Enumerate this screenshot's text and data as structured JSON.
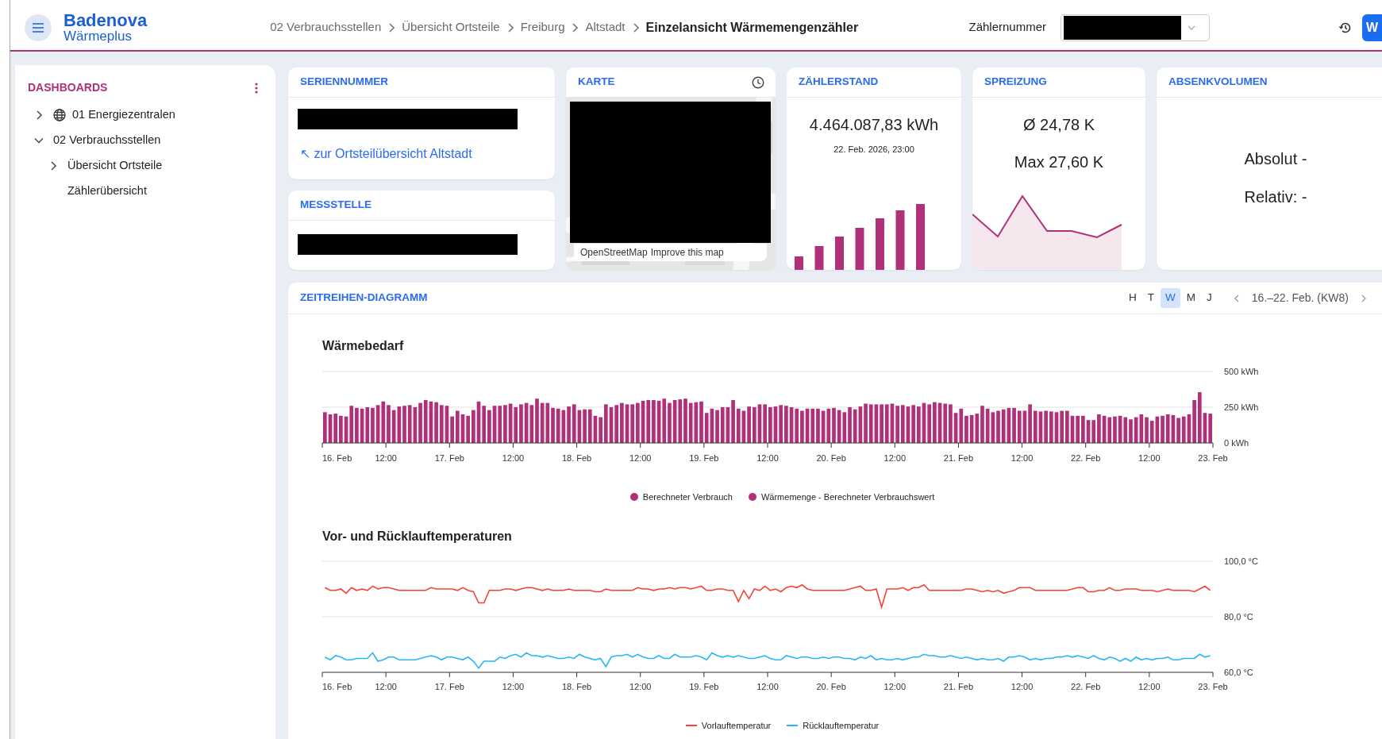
{
  "header": {
    "logo": {
      "brand": "Badenova",
      "product": "Wärmeplus"
    },
    "breadcrumbs": [
      {
        "label": "02 Verbrauchsstellen",
        "current": false
      },
      {
        "label": "Übersicht Ortsteile",
        "current": false
      },
      {
        "label": "Freiburg",
        "current": false
      },
      {
        "label": "Altstadt",
        "current": false
      },
      {
        "label": "Einzelansicht Wärmemengenzähler",
        "current": true
      }
    ],
    "meter_field": {
      "label": "Zählernummer"
    },
    "user_button": {
      "label": "W"
    }
  },
  "sidebar": {
    "title": "DASHBOARDS",
    "items": [
      {
        "label": "01 Energiezentralen",
        "kind": "icon",
        "expanded": false
      },
      {
        "label": "02 Verbrauchsstellen",
        "kind": "plain",
        "expanded": true,
        "children": [
          {
            "label": "Übersicht Ortsteile",
            "kind": "plain",
            "expanded": false
          },
          {
            "label": "Zählerübersicht",
            "kind": "plain"
          }
        ]
      }
    ]
  },
  "serial_card": {
    "title": "SERIENNUMMER",
    "link": "↖ zur Ortsteilübersicht Altstadt"
  },
  "location_card": {
    "title": "MESSSTELLE"
  },
  "map_card": {
    "title": "KARTE",
    "attribution": [
      "OpenStreetMap",
      "Improve this map"
    ]
  },
  "meter_reading_card": {
    "title": "ZÄHLERSTAND",
    "value": "4.464.087,83 kWh",
    "timestamp": "22. Feb. 2026, 23:00"
  },
  "spread_card": {
    "title": "SPREIZUNG",
    "average": "Ø 24,78 K",
    "maximum": "Max 27,60 K"
  },
  "reduction_card": {
    "title": "ABSENKVOLUMEN",
    "absolute": "Absolut -",
    "relative": "Relativ: -"
  },
  "timeseries": {
    "title": "ZEITREIHEN-DIAGRAMM",
    "resolutions": [
      {
        "label": "H",
        "selected": false
      },
      {
        "label": "T",
        "selected": false
      },
      {
        "label": "W",
        "selected": true
      },
      {
        "label": "M",
        "selected": false
      },
      {
        "label": "J",
        "selected": false
      }
    ],
    "period": "16.–22. Feb. (KW8)",
    "charts": [
      {
        "x_axis_labels": [
          "16. Feb",
          "12:00",
          "17. Feb",
          "12:00",
          "18. Feb",
          "12:00",
          "19. Feb",
          "12:00",
          "20. Feb",
          "12:00",
          "21. Feb",
          "12:00",
          "22. Feb",
          "12:00",
          "23. Feb"
        ],
        "chart_data": {
          "type": "bar",
          "title": "Wärmebedarf",
          "ylim": [
            0,
            500
          ],
          "legend": "bottom",
          "yticks": [
            {
              "value": 0,
              "label": "0 kWh"
            },
            {
              "value": 250,
              "label": "250 kWh"
            },
            {
              "value": 500,
              "label": "500 kWh"
            }
          ],
          "series": [
            {
              "name": "Berechneter Verbrauch",
              "color": "#b0307a",
              "values": [
                215,
                200,
                205,
                190,
                185,
                260,
                245,
                240,
                250,
                245,
                265,
                290,
                265,
                230,
                255,
                260,
                265,
                250,
                280,
                300,
                290,
                285,
                265,
                260,
                185,
                225,
                200,
                190,
                230,
                290,
                260,
                230,
                260,
                260,
                265,
                275,
                250,
                270,
                280,
                265,
                310,
                280,
                280,
                245,
                240,
                230,
                255,
                270,
                230,
                235,
                235,
                190,
                180,
                270,
                250,
                265,
                280,
                270,
                270,
                280,
                295,
                300,
                300,
                295,
                310,
                280,
                300,
                305,
                310,
                280,
                285,
                290,
                210,
                240,
                230,
                250,
                250,
                300,
                240,
                225,
                255,
                250,
                270,
                270,
                250,
                255,
                265,
                260,
                250,
                240,
                225,
                240,
                240,
                240,
                225,
                240,
                245,
                230,
                215,
                250,
                235,
                255,
                275,
                270,
                270,
                270,
                270,
                275,
                260,
                265,
                255,
                265,
                255,
                280,
                270,
                285,
                280,
                275,
                270,
                210,
                240,
                190,
                195,
                205,
                260,
                240,
                215,
                225,
                235,
                245,
                245,
                225,
                225,
                270,
                225,
                220,
                225,
                220,
                215,
                225,
                225,
                190,
                190,
                190,
                160,
                160,
                200,
                190,
                180,
                185,
                190,
                180,
                165,
                180,
                200,
                180,
                155,
                185,
                190,
                200,
                195,
                175,
                185,
                200,
                300,
                355,
                210,
                205
              ]
            },
            {
              "name": "Wärmemenge - Berechneter Verbrauchswert",
              "color": "#b0307a",
              "values": [
                null,
                null,
                null,
                null,
                null,
                null,
                null,
                null,
                null,
                null,
                null,
                null,
                null,
                null,
                null,
                null,
                null,
                null,
                null,
                null,
                null,
                null,
                null,
                null,
                null,
                null,
                null,
                null,
                null,
                null,
                null,
                null,
                null,
                null,
                null,
                null,
                null,
                null,
                null,
                null,
                null,
                null,
                null,
                null,
                null,
                null,
                null,
                null,
                null,
                null,
                null,
                null,
                null,
                null,
                null,
                null,
                null,
                null,
                null,
                null,
                null,
                null,
                null,
                null,
                null,
                null,
                null,
                null,
                null,
                null,
                null,
                null,
                null,
                null,
                null,
                null,
                null,
                null,
                null,
                null,
                null,
                null,
                null,
                null,
                null,
                null,
                null,
                null,
                null,
                null,
                null,
                null,
                null,
                null,
                null,
                null,
                null,
                null,
                null,
                null,
                null,
                null,
                null,
                null,
                null,
                null,
                null,
                null,
                null,
                null,
                null,
                null,
                null,
                null,
                null,
                null,
                null,
                null,
                null,
                null,
                null,
                null,
                null,
                null,
                null,
                null,
                null,
                null,
                null,
                null,
                null,
                null,
                null,
                null,
                null,
                null,
                null,
                null,
                null,
                null,
                null,
                null,
                null,
                null,
                null,
                null,
                null,
                null,
                null,
                null,
                null,
                null,
                null,
                null,
                null,
                null,
                null,
                null,
                null,
                null,
                null,
                null,
                null,
                null,
                null,
                null,
                null,
                null
              ]
            }
          ]
        }
      },
      {
        "x_axis_labels": [
          "16. Feb",
          "12:00",
          "17. Feb",
          "12:00",
          "18. Feb",
          "12:00",
          "19. Feb",
          "12:00",
          "20. Feb",
          "12:00",
          "21. Feb",
          "12:00",
          "22. Feb",
          "12:00",
          "23. Feb"
        ],
        "chart_data": {
          "type": "line",
          "title": "Vor- und Rücklauftemperaturen",
          "ylim": [
            60,
            100
          ],
          "legend": "bottom",
          "yticks": [
            {
              "value": 60,
              "label": "60,0 °C"
            },
            {
              "value": 80,
              "label": "80,0 °C"
            },
            {
              "value": 100,
              "label": "100,0 °C"
            }
          ],
          "series": [
            {
              "name": "Vorlauftemperatur",
              "color": "#f44336",
              "values": [
                90.5,
                89.5,
                89.5,
                90,
                88.5,
                90.5,
                89.5,
                90,
                89.5,
                91,
                90,
                90.5,
                90.5,
                90,
                89.5,
                89.5,
                89.5,
                89.5,
                89.5,
                89.5,
                90.5,
                90,
                90,
                90,
                90,
                89.5,
                90.5,
                89.5,
                89,
                85,
                85,
                89.5,
                89.5,
                89.5,
                90,
                90,
                89.5,
                90,
                90.5,
                90.5,
                90,
                89.5,
                90,
                89.5,
                89.5,
                89.5,
                90,
                89.5,
                89.5,
                89.5,
                89.5,
                89,
                89,
                90,
                89.5,
                89.5,
                89.5,
                89.5,
                89.5,
                90.5,
                90,
                90,
                89.5,
                90,
                90,
                90.5,
                90,
                90.5,
                90.5,
                90,
                90.5,
                91,
                89.5,
                89.5,
                90,
                90,
                89.5,
                89.5,
                85.5,
                89.5,
                86.5,
                90,
                89.5,
                91,
                89.5,
                90,
                89,
                90.5,
                91,
                90.5,
                91.5,
                90,
                89.5,
                89.5,
                89.5,
                89.5,
                89.5,
                89.5,
                89.5,
                90,
                90.5,
                91,
                89.5,
                89.5,
                90,
                83.5,
                90,
                90,
                90,
                90.5,
                89.5,
                90.5,
                90.5,
                91.5,
                89.5,
                89.5,
                89.5,
                89.5,
                89.5,
                89.5,
                89.5,
                90,
                90,
                89.5,
                89,
                89.5,
                89,
                89.5,
                88.5,
                89,
                89.5,
                90.5,
                90.5,
                90.5,
                89.5,
                89.5,
                89.5,
                89.5,
                89.5,
                89.5,
                89.5,
                90,
                90.5,
                90.5,
                89,
                89,
                89.5,
                89.5,
                90.5,
                89.5,
                89.5,
                90,
                90,
                90,
                89.5,
                89.5,
                89.5,
                89,
                89.5,
                90,
                89.5,
                89.5,
                89.5,
                89.5,
                89,
                90,
                91,
                89.5
              ]
            },
            {
              "name": "Rücklauftemperatur",
              "color": "#29b6f6",
              "values": [
                65.5,
                64.5,
                66,
                65.5,
                64.5,
                64.5,
                65,
                65,
                65,
                67,
                64,
                64.5,
                65.5,
                65.5,
                64.5,
                64.5,
                64.5,
                64.5,
                65,
                65.5,
                66,
                65.5,
                64.5,
                65.5,
                65.5,
                65,
                64.5,
                65.5,
                64,
                61.5,
                64,
                64,
                64,
                65.5,
                65,
                66,
                66.5,
                65.5,
                67,
                66,
                66,
                65.5,
                66,
                65.5,
                65,
                65,
                65.5,
                65,
                66.5,
                65.5,
                65,
                64.5,
                65,
                62,
                65.5,
                66,
                66,
                66.5,
                65.5,
                66.5,
                65.5,
                65,
                65,
                66,
                65,
                65,
                66.5,
                65.5,
                65.5,
                65.5,
                66,
                65.5,
                64.5,
                67,
                66,
                65.5,
                66,
                65.5,
                66,
                65.5,
                65,
                65,
                65.5,
                66,
                65,
                64.5,
                64.5,
                66,
                65.5,
                65,
                65.5,
                65.5,
                65,
                65,
                65.5,
                65,
                65.5,
                65.5,
                65,
                65,
                64.5,
                65.5,
                65,
                66,
                64.5,
                65,
                64.5,
                64.5,
                65,
                64.5,
                65,
                65.5,
                65.5,
                66.5,
                66,
                66,
                65.5,
                65.5,
                66,
                65.5,
                65,
                65.5,
                65,
                64.5,
                65,
                64.5,
                64.5,
                65,
                64,
                65.5,
                65.5,
                66,
                65.5,
                64.5,
                65,
                64.5,
                65,
                65,
                65.5,
                65.5,
                66,
                65.5,
                66,
                65.5,
                65,
                66,
                65,
                64.5,
                65.5,
                65,
                64,
                65,
                64,
                65.5,
                64.5,
                65,
                64.5,
                65,
                65,
                65.5,
                64.5,
                64.5,
                65,
                65,
                65,
                66.5,
                65.5,
                66
              ]
            }
          ]
        }
      }
    ]
  }
}
